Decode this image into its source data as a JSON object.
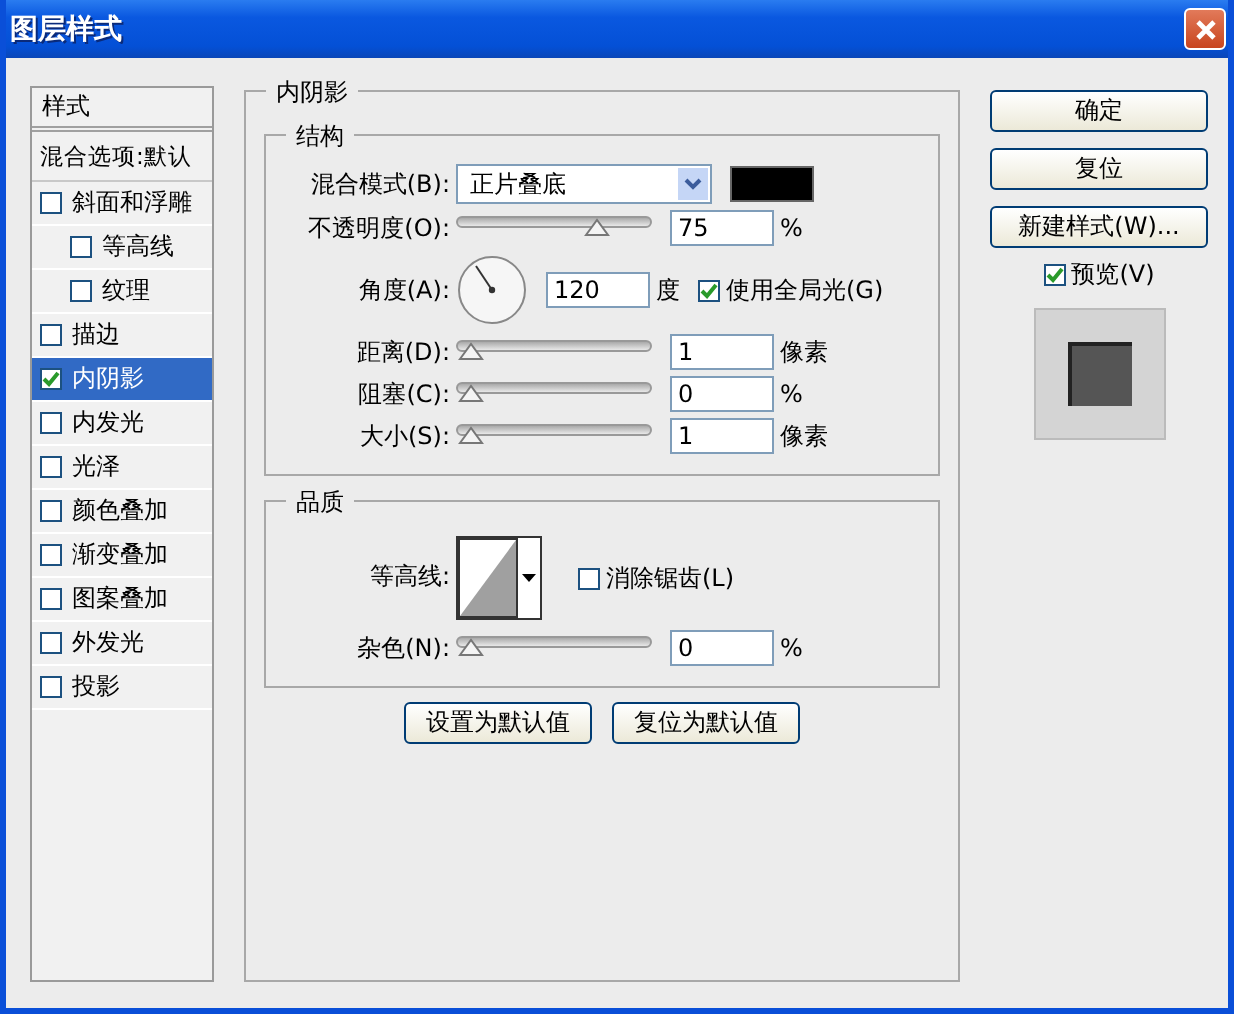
{
  "window": {
    "title": "图层样式"
  },
  "style_list": {
    "header": "样式",
    "blend_options": "混合选项:默认",
    "items": [
      {
        "label": "斜面和浮雕",
        "checked": false,
        "selected": false,
        "children": [
          {
            "label": "等高线",
            "checked": false,
            "selected": false
          },
          {
            "label": "纹理",
            "checked": false,
            "selected": false
          }
        ]
      },
      {
        "label": "描边",
        "checked": false,
        "selected": false
      },
      {
        "label": "内阴影",
        "checked": true,
        "selected": true
      },
      {
        "label": "内发光",
        "checked": false,
        "selected": false
      },
      {
        "label": "光泽",
        "checked": false,
        "selected": false
      },
      {
        "label": "颜色叠加",
        "checked": false,
        "selected": false
      },
      {
        "label": "渐变叠加",
        "checked": false,
        "selected": false
      },
      {
        "label": "图案叠加",
        "checked": false,
        "selected": false
      },
      {
        "label": "外发光",
        "checked": false,
        "selected": false
      },
      {
        "label": "投影",
        "checked": false,
        "selected": false
      }
    ]
  },
  "panel": {
    "title": "内阴影",
    "structure": {
      "title": "结构",
      "rows": [
        {
          "kind": "dropdown",
          "label": "混合模式(B):",
          "value": "正片叠底",
          "color": "#000000"
        },
        {
          "kind": "slider",
          "label": "不透明度(O):",
          "level": 0.75,
          "value": "75",
          "unit": "%"
        },
        {
          "kind": "angle",
          "label": "角度(A):",
          "value": "120",
          "unit": "度",
          "option": {
            "label": "使用全局光(G)",
            "checked": true
          }
        },
        {
          "kind": "slider",
          "label": "距离(D):",
          "level": 0,
          "value": "1",
          "unit": "像素"
        },
        {
          "kind": "slider",
          "label": "阻塞(C):",
          "level": 0,
          "value": "0",
          "unit": "%"
        },
        {
          "kind": "slider",
          "label": "大小(S):",
          "level": 0,
          "value": "1",
          "unit": "像素"
        }
      ]
    },
    "quality": {
      "title": "品质",
      "rows": [
        {
          "kind": "contour",
          "label": "等高线:",
          "option": {
            "label": "消除锯齿(L)",
            "checked": false
          }
        },
        {
          "kind": "slider",
          "label": "杂色(N):",
          "level": 0,
          "value": "0",
          "unit": "%"
        }
      ]
    },
    "buttons": [
      "设置为默认值",
      "复位为默认值"
    ]
  },
  "actions": {
    "buttons": [
      "确定",
      "复位",
      "新建样式(W)..."
    ],
    "preview": {
      "label": "预览(V)",
      "checked": true
    }
  }
}
